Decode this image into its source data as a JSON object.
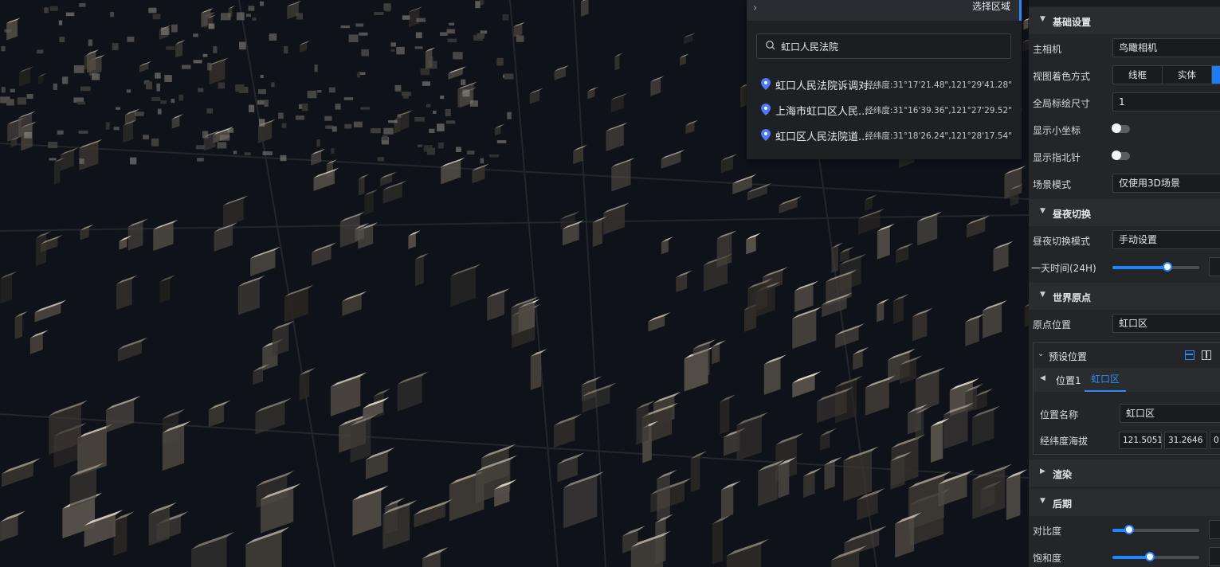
{
  "search": {
    "header_title": "选择区域",
    "query": "虹口人民法院",
    "results": [
      {
        "name": "虹口人民法院诉调对...",
        "coord": "经纬度:31°17'21.48\",121°29'41.28\""
      },
      {
        "name": "上海市虹口区人民...",
        "coord": "经纬度:31°16'39.36\",121°27'29.52\""
      },
      {
        "name": "虹口区人民法院道...",
        "coord": "经纬度:31°18'26.24\",121°28'17.54\""
      }
    ]
  },
  "panel": {
    "basic": {
      "title": "基础设置",
      "camera_label": "主相机",
      "camera_value": "鸟瞰相机",
      "shading_label": "视图着色方式",
      "shading_options": [
        "线框",
        "实体"
      ],
      "marker_size_label": "全局标绘尺寸",
      "marker_size_value": "1",
      "show_axis_label": "显示小坐标",
      "show_compass_label": "显示指北针",
      "scene_mode_label": "场景模式",
      "scene_mode_value": "仅使用3D场景"
    },
    "daynight": {
      "title": "昼夜切换",
      "mode_label": "昼夜切换模式",
      "mode_value": "手动设置",
      "time_label": "一天时间(24H)",
      "time_fraction": 0.63
    },
    "origin": {
      "title": "世界原点",
      "position_label": "原点位置",
      "position_value": "虹口区",
      "preset": {
        "title": "预设位置",
        "tab1": "位置1",
        "tab2": "虹口区",
        "name_label": "位置名称",
        "name_value": "虹口区",
        "lnglat_label": "经纬度海拔",
        "lng": "121.50513",
        "lat": "31.2646",
        "alt": "0"
      }
    },
    "render": {
      "title": "渲染"
    },
    "post": {
      "title": "后期",
      "contrast_label": "对比度",
      "contrast_fraction": 0.19,
      "saturation_label": "饱和度",
      "saturation_fraction": 0.43
    }
  },
  "colors": {
    "accent": "#1f86ff",
    "pin": "#4f79f5"
  }
}
